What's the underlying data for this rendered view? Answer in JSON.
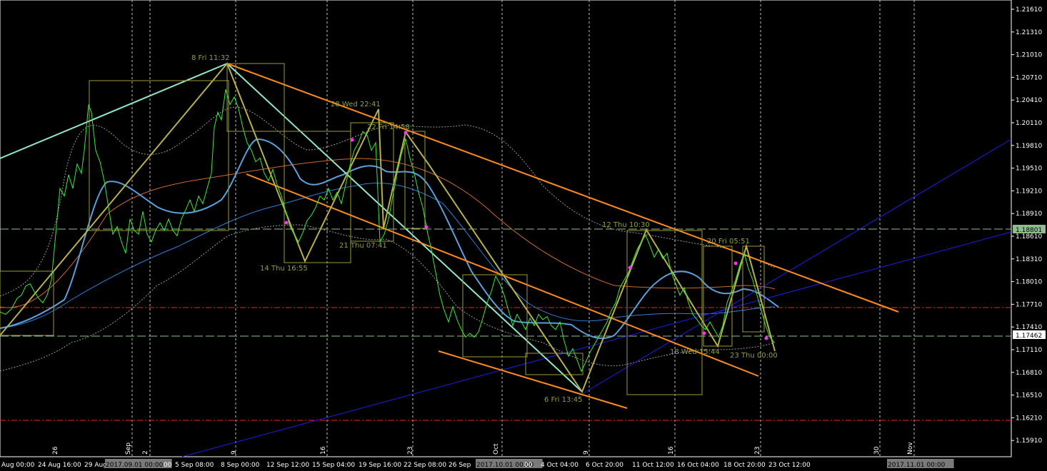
{
  "chart_data": {
    "type": "line",
    "title": "",
    "ylim": [
      1.1591,
      1.2176
    ],
    "price_axis": {
      "ticks": [
        "1.21610",
        "1.21310",
        "1.21010",
        "1.20710",
        "1.20410",
        "1.20110",
        "1.19810",
        "1.19510",
        "1.19210",
        "1.18910",
        "1.18610",
        "1.18310",
        "1.18010",
        "1.17710",
        "1.17410",
        "1.17110",
        "1.16810",
        "1.16510",
        "1.16210",
        "1.15910"
      ],
      "current_price_label": "1.18801",
      "bid_price_label": "1.17462",
      "current_price": 1.18801,
      "bid_price": 1.17462
    },
    "time_axis": {
      "labels": [
        "Aug 00:00",
        "24 Aug 16:00",
        "29 Aug",
        "2017.09.01 00:00",
        "00",
        "5 Sep 08:00",
        "8 Sep 00:00",
        "12 Sep 12:00",
        "15 Sep 04:00",
        "19 Sep 16:00",
        "22 Sep 08:00",
        "26 Sep",
        "2017.10.01 00:00",
        "00",
        "4 Oct 04:00",
        "6 Oct 20:00",
        "11 Oct 12:00",
        "16 Oct 04:00",
        "18 Oct 20:00",
        "23 Oct 12:00",
        "2017.11.01 00:00"
      ],
      "day_markers": [
        "26",
        "Sep",
        "2",
        "9",
        "16",
        "23",
        "Oct",
        "9",
        "16",
        "23",
        "30",
        "Nov"
      ]
    },
    "annotations": [
      "8 Fri 11:32",
      "28 Wed 22:41",
      "22 Fri 14:58",
      "14 Thu 16:55",
      "21 Thu 07:41",
      "12 Thu 10:30",
      "20 Fri 05:51",
      "6 Fri 13:45",
      "18 Wed 15:44",
      "23 Thu 00:00"
    ],
    "series": [
      {
        "color": "#33ee33",
        "points": [
          [
            0,
            1.1778
          ],
          [
            8,
            1.1775
          ],
          [
            16,
            1.1782
          ],
          [
            24,
            1.1796
          ],
          [
            30,
            1.18
          ],
          [
            36,
            1.1812
          ],
          [
            42,
            1.1815
          ],
          [
            48,
            1.1805
          ],
          [
            54,
            1.1796
          ],
          [
            60,
            1.179
          ],
          [
            66,
            1.18
          ],
          [
            72,
            1.182
          ],
          [
            78,
            1.188
          ],
          [
            84,
            1.194
          ],
          [
            90,
            1.193
          ],
          [
            96,
            1.1958
          ],
          [
            102,
            1.194
          ],
          [
            108,
            1.1972
          ],
          [
            114,
            1.196
          ],
          [
            118,
            1.199
          ],
          [
            124,
            1.205
          ],
          [
            128,
            1.204
          ],
          [
            134,
            1.199
          ],
          [
            140,
            1.1975
          ],
          [
            146,
            1.195
          ],
          [
            152,
            1.1915
          ],
          [
            158,
            1.188
          ],
          [
            164,
            1.189
          ],
          [
            170,
            1.187
          ],
          [
            176,
            1.1855
          ],
          [
            182,
            1.19
          ],
          [
            188,
            1.1885
          ],
          [
            194,
            1.188
          ],
          [
            200,
            1.191
          ],
          [
            206,
            1.188
          ],
          [
            212,
            1.187
          ],
          [
            218,
            1.1885
          ],
          [
            224,
            1.1895
          ],
          [
            230,
            1.1885
          ],
          [
            236,
            1.19
          ],
          [
            242,
            1.1885
          ],
          [
            248,
            1.1878
          ],
          [
            254,
            1.19
          ],
          [
            260,
            1.1912
          ],
          [
            266,
            1.1925
          ],
          [
            272,
            1.191
          ],
          [
            278,
            1.193
          ],
          [
            284,
            1.192
          ],
          [
            290,
            1.194
          ],
          [
            296,
            1.196
          ],
          [
            300,
            1.202
          ],
          [
            305,
            1.204
          ],
          [
            310,
            1.203
          ],
          [
            316,
            1.207
          ],
          [
            322,
            1.205
          ],
          [
            328,
            1.206
          ],
          [
            334,
            1.2045
          ],
          [
            340,
            1.202
          ],
          [
            346,
            1.2
          ],
          [
            352,
            1.199
          ],
          [
            358,
            1.1975
          ],
          [
            364,
            1.198
          ],
          [
            370,
            1.196
          ],
          [
            376,
            1.195
          ],
          [
            382,
            1.1965
          ],
          [
            388,
            1.1945
          ],
          [
            394,
            1.193
          ],
          [
            400,
            1.191
          ],
          [
            406,
            1.189
          ],
          [
            412,
            1.188
          ],
          [
            418,
            1.187
          ],
          [
            424,
            1.1882
          ],
          [
            430,
            1.1898
          ],
          [
            436,
            1.1905
          ],
          [
            442,
            1.1915
          ],
          [
            448,
            1.193
          ],
          [
            454,
            1.1925
          ],
          [
            460,
            1.194
          ],
          [
            466,
            1.1925
          ],
          [
            472,
            1.1935
          ],
          [
            478,
            1.192
          ],
          [
            484,
            1.1945
          ],
          [
            490,
            1.197
          ],
          [
            496,
            1.199
          ],
          [
            502,
            1.2
          ],
          [
            508,
            1.2015
          ],
          [
            514,
            1.201
          ],
          [
            520,
            1.199
          ],
          [
            526,
            1.2
          ],
          [
            532,
            1.187
          ],
          [
            538,
            1.188
          ],
          [
            544,
            1.19
          ],
          [
            550,
            1.193
          ],
          [
            556,
            1.196
          ],
          [
            562,
            1.1985
          ],
          [
            568,
            1.2005
          ],
          [
            574,
            1.198
          ],
          [
            580,
            1.196
          ],
          [
            586,
            1.1935
          ],
          [
            592,
            1.1915
          ],
          [
            598,
            1.1885
          ],
          [
            604,
            1.186
          ],
          [
            610,
            1.183
          ],
          [
            616,
            1.18
          ],
          [
            622,
            1.178
          ],
          [
            628,
            1.1765
          ],
          [
            634,
            1.1785
          ],
          [
            640,
            1.1768
          ],
          [
            646,
            1.1755
          ],
          [
            652,
            1.1745
          ],
          [
            658,
            1.175
          ],
          [
            664,
            1.1745
          ],
          [
            670,
            1.1752
          ],
          [
            676,
            1.177
          ],
          [
            682,
            1.179
          ],
          [
            688,
            1.1805
          ],
          [
            694,
            1.1825
          ],
          [
            700,
            1.1815
          ],
          [
            706,
            1.18
          ],
          [
            712,
            1.178
          ],
          [
            718,
            1.176
          ],
          [
            724,
            1.1775
          ],
          [
            730,
            1.1765
          ],
          [
            736,
            1.1755
          ],
          [
            742,
            1.177
          ],
          [
            748,
            1.176
          ],
          [
            754,
            1.1775
          ],
          [
            760,
            1.1768
          ],
          [
            766,
            1.1772
          ],
          [
            772,
            1.176
          ],
          [
            778,
            1.1755
          ],
          [
            784,
            1.1765
          ],
          [
            790,
            1.174
          ],
          [
            796,
            1.172
          ],
          [
            802,
            1.173
          ],
          [
            808,
            1.1715
          ],
          [
            814,
            1.17
          ],
          [
            820,
            1.1712
          ],
          [
            826,
            1.1725
          ],
          [
            832,
            1.1735
          ],
          [
            838,
            1.1745
          ],
          [
            844,
            1.1755
          ],
          [
            850,
            1.1765
          ],
          [
            856,
            1.178
          ],
          [
            862,
            1.179
          ],
          [
            868,
            1.181
          ],
          [
            874,
            1.182
          ],
          [
            880,
            1.183
          ],
          [
            886,
            1.1845
          ],
          [
            892,
            1.186
          ],
          [
            898,
            1.187
          ],
          [
            904,
            1.1879
          ],
          [
            910,
            1.1865
          ],
          [
            916,
            1.185
          ],
          [
            922,
            1.186
          ],
          [
            928,
            1.1848
          ],
          [
            934,
            1.1855
          ],
          [
            940,
            1.183
          ],
          [
            946,
            1.1815
          ],
          [
            952,
            1.18
          ],
          [
            958,
            1.181
          ],
          [
            964,
            1.179
          ],
          [
            970,
            1.1775
          ],
          [
            976,
            1.1768
          ],
          [
            982,
            1.176
          ],
          [
            988,
            1.1755
          ],
          [
            994,
            1.1765
          ],
          [
            1000,
            1.1755
          ],
          [
            1006,
            1.1745
          ],
          [
            1012,
            1.176
          ],
          [
            1018,
            1.179
          ],
          [
            1024,
            1.1805
          ],
          [
            1030,
            1.182
          ],
          [
            1036,
            1.184
          ],
          [
            1042,
            1.1855
          ],
          [
            1048,
            1.1835
          ],
          [
            1054,
            1.182
          ],
          [
            1060,
            1.18
          ],
          [
            1066,
            1.178
          ],
          [
            1072,
            1.176
          ],
          [
            1078,
            1.1745
          ],
          [
            1084,
            1.1738
          ]
        ]
      }
    ]
  }
}
